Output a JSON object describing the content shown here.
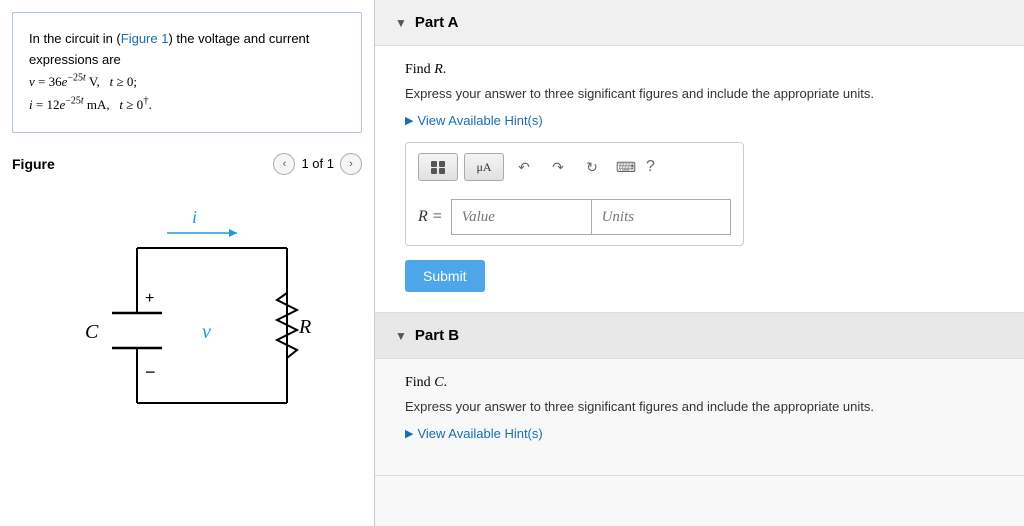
{
  "left": {
    "problem": {
      "intro": "In the circuit in (",
      "figure_ref": "Figure 1",
      "intro_end": ") the voltage and current expressions are",
      "eq1": "v = 36e",
      "eq1_exp": "−25t",
      "eq1_unit": " V,",
      "eq1_condition": "  t ≥ 0;",
      "eq2": "i = 12e",
      "eq2_exp": "−25t",
      "eq2_unit": " mA,",
      "eq2_condition": "  t ≥ 0",
      "eq2_sup": "†"
    },
    "figure": {
      "title": "Figure",
      "nav_text": "1 of 1"
    }
  },
  "right": {
    "partA": {
      "label": "Part A",
      "find_text": "Find R.",
      "instruction": "Express your answer to three significant figures and include the appropriate units.",
      "hint_label": "View Available Hint(s)",
      "r_label": "R =",
      "value_placeholder": "Value",
      "units_placeholder": "Units",
      "submit_label": "Submit"
    },
    "partB": {
      "label": "Part B",
      "find_text": "Find C.",
      "instruction": "Express your answer to three significant figures and include the appropriate units.",
      "hint_label": "View Available Hint(s)"
    }
  },
  "toolbar": {
    "undo": "↺",
    "redo": "↻",
    "refresh": "↺",
    "keyboard": "⌨",
    "help": "?"
  }
}
